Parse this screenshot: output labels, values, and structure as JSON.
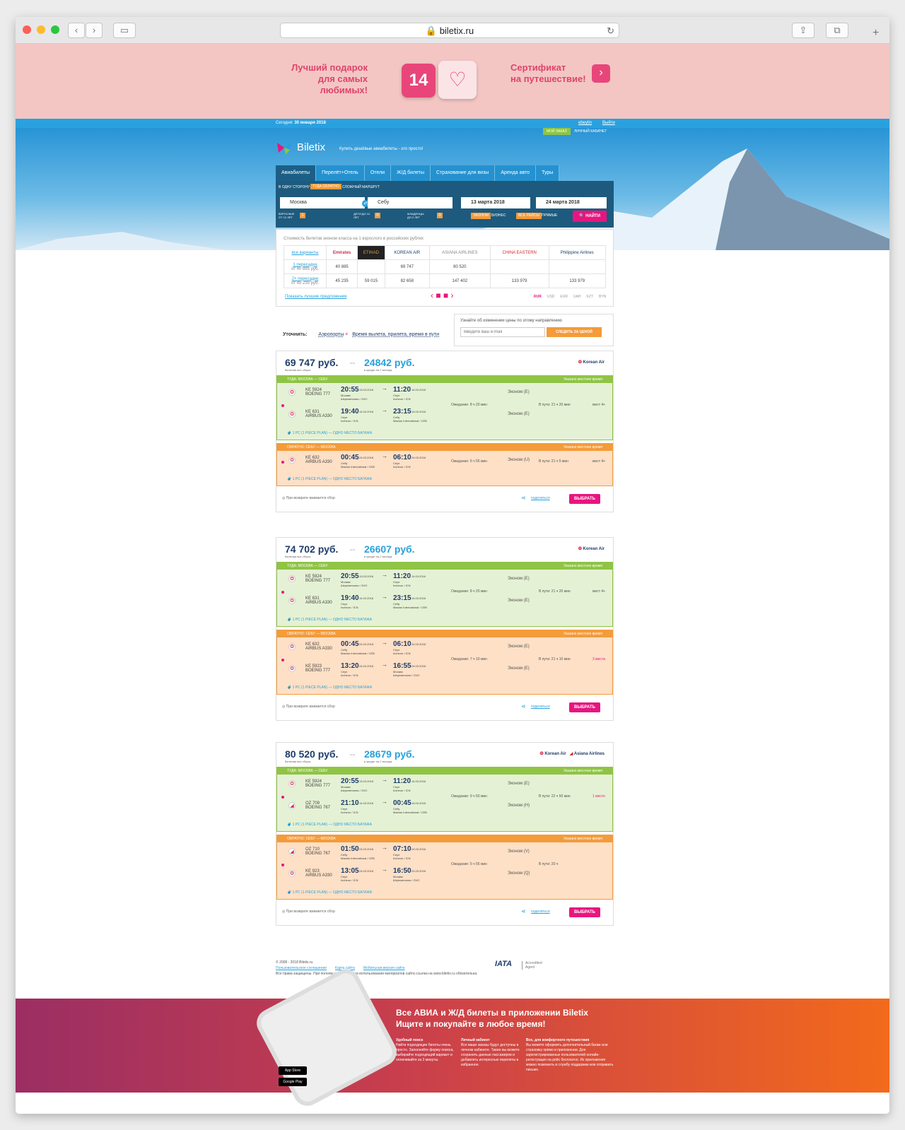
{
  "browser": {
    "url": "biletix.ru"
  },
  "banner": {
    "left": "Лучший подарок\nдля самых любимых!",
    "date": "14",
    "right": "Сертификат\nна путешествие!"
  },
  "header": {
    "today_label": "Сегодня:",
    "today": "30 января 2018",
    "user": "ebeylin",
    "logout": "Выйти",
    "my_order": "МОЙ ЗАКАЗ",
    "cabinet": "ЛИЧНЫЙ КАБИНЕТ",
    "brand": "Biletix",
    "tagline": "Купить дешёвые авиабилеты - это просто!"
  },
  "tabs": [
    "Авиабилеты",
    "Перелёт+Отель",
    "Отели",
    "Ж/Д билеты",
    "Страхование для визы",
    "Аренда авто",
    "Туры"
  ],
  "form": {
    "modes": [
      "В ОДНУ СТОРОНУ",
      "ТУДА-ОБРАТНО",
      "СЛОЖНЫЙ МАРШРУТ"
    ],
    "from": "Москва",
    "to": "Себу",
    "date1": "13 марта 2018",
    "date2": "24 марта 2018",
    "adults": "ВЗРОСЛЫЕ ОТ 12 ЛЕТ",
    "children": "ДЕТИ ДО 12 ЛЕТ",
    "infants": "МЛАДЕНЦЫ ДО 2 ЛЕТ",
    "adults_n": "1",
    "zero": "0",
    "classes": [
      "ЭКОНОМ",
      "БИЗНЕС"
    ],
    "flights": [
      "ВСЕ РЕЙСЫ",
      "ПРЯМЫЕ"
    ],
    "search": "НАЙТИ"
  },
  "matrix": {
    "title": "Стоимость билетов эконом класса на 1 взрослого в российских рублях",
    "airlines": [
      "Emirates",
      "ETIHAD",
      "KOREAN AIR",
      "ASIANA AIRLINES",
      "CHINA EASTERN",
      "Philippine Airlines"
    ],
    "rows": [
      {
        "label": "все варианты",
        "sub": ""
      },
      {
        "label": "1 пересадка",
        "sub": "от 40 885 руб.",
        "cells": [
          "40 885",
          "",
          "69 747",
          "80 520",
          "",
          ""
        ]
      },
      {
        "label": "2+ пересадки",
        "sub": "от 45 235 руб.",
        "cells": [
          "45 235",
          "59 015",
          "82 658",
          "147 402",
          "133 979",
          "133 979"
        ]
      }
    ],
    "best": "Показать лучшие предложения",
    "currencies": [
      "RUR",
      "USD",
      "EUR",
      "UAH",
      "KZT",
      "BYN"
    ]
  },
  "notify": {
    "text": "Узнайте об изменении цены по этому направлению",
    "placeholder": "Введите ваш e-mail",
    "button": "СЛЕДИТЬ ЗА ЦЕНОЙ"
  },
  "filters": {
    "label": "Уточнить:",
    "airports": "Аэропорты",
    "times": "Время вылета, прилета, время в пути"
  },
  "common": {
    "fees": "Включая все сборы",
    "or": "или",
    "credit": "в кредит на 2 месяца",
    "local": "Указано местное время",
    "baggage": "1 PC (1 PIECE PLAN) — ОДНО МЕСТО БАГАЖА",
    "refund": "При возврате взимается сбор",
    "share": "поделиться",
    "choose": "ВЫБРАТЬ"
  },
  "offers": [
    {
      "price": "69 747 руб.",
      "credit": "24842 руб.",
      "airline": "Korean Air",
      "there_title": "ТУДА: МОСКВА — СЕБУ",
      "back_title": "ОБРАТНО: СЕБУ — МОСКВА",
      "there": [
        {
          "num": "KE 5924",
          "ac": "BOEING 777",
          "dep": "20:55",
          "dd": "13.03.2018",
          "dc": "Москва",
          "da": "Шереметьево / SVO",
          "arr": "11:20",
          "ad": "14.03.2018",
          "ac2": "Сеул",
          "aa": "Incheon / ICN",
          "cls": "Эконом (E)"
        },
        {
          "num": "KE 631",
          "ac": "AIRBUS A330",
          "dep": "19:40",
          "dd": "14.03.2018",
          "dc": "Сеул",
          "da": "Incheon / ICN",
          "arr": "23:15",
          "ad": "14.03.2018",
          "ac2": "Себу",
          "aa": "Mactan International / CEB",
          "cls": "Эконом (E)"
        }
      ],
      "there_wait": "Ожидание: 8 ч 20 мин",
      "there_time": "В пути: 21 ч 20 мин",
      "there_seats": "мест 4+",
      "back": [
        {
          "num": "KE 632",
          "ac": "AIRBUS A330",
          "dep": "00:45",
          "dd": "24.03.2018",
          "dc": "Себу",
          "da": "Mactan International / CEB",
          "arr": "06:10",
          "ad": "24.03.2018",
          "ac2": "Сеул",
          "aa": "Incheon / ICN",
          "cls": "Эконом (U)"
        }
      ],
      "back_wait": "Ожидание: 6 ч 55 мин",
      "back_time": "В пути: 21 ч 5 мин",
      "back_seats": "мест 4+"
    },
    {
      "price": "74 702 руб.",
      "credit": "26607 руб.",
      "airline": "Korean Air",
      "there_title": "ТУДА: МОСКВА — СЕБУ",
      "back_title": "ОБРАТНО: СЕБУ — МОСКВА",
      "there": [
        {
          "num": "KE 5924",
          "ac": "BOEING 777",
          "dep": "20:55",
          "dd": "13.03.2018",
          "dc": "Москва",
          "da": "Шереметьево / SVO",
          "arr": "11:20",
          "ad": "14.03.2018",
          "ac2": "Сеул",
          "aa": "Incheon / ICN",
          "cls": "Эконом (E)"
        },
        {
          "num": "KE 631",
          "ac": "AIRBUS A330",
          "dep": "19:40",
          "dd": "14.03.2018",
          "dc": "Сеул",
          "da": "Incheon / ICN",
          "arr": "23:15",
          "ad": "14.03.2018",
          "ac2": "Себу",
          "aa": "Mactan International / CEB",
          "cls": "Эконом (E)"
        }
      ],
      "there_wait": "Ожидание: 8 ч 20 мин",
      "there_time": "В пути: 21 ч 20 мин",
      "there_seats": "мест 4+",
      "back": [
        {
          "num": "KE 632",
          "ac": "AIRBUS A330",
          "dep": "00:45",
          "dd": "24.03.2018",
          "dc": "Себу",
          "da": "Mactan International / CEB",
          "arr": "06:10",
          "ad": "24.03.2018",
          "ac2": "Сеул",
          "aa": "Incheon / ICN",
          "cls": "Эконом (E)"
        },
        {
          "num": "KE 5923",
          "ac": "BOEING 777",
          "dep": "13:20",
          "dd": "24.03.2018",
          "dc": "Сеул",
          "da": "Incheon / ICN",
          "arr": "16:55",
          "ad": "24.03.2018",
          "ac2": "Москва",
          "aa": "Шереметьево / SVO",
          "cls": "Эконом (E)"
        }
      ],
      "back_wait": "Ожидание: 7 ч 10 мин",
      "back_time": "В пути: 21 ч 10 мин",
      "back_seats": "3 места"
    },
    {
      "price": "80 520 руб.",
      "credit": "28679 руб.",
      "airline": "Korean Air",
      "airline2": "Asiana Airlines",
      "there_title": "ТУДА: МОСКВА — СЕБУ",
      "back_title": "ОБРАТНО: СЕБУ — МОСКВА",
      "there": [
        {
          "num": "KE 5924",
          "ac": "BOEING 777",
          "dep": "20:55",
          "dd": "13.03.2018",
          "dc": "Москва",
          "da": "Шереметьево / SVO",
          "arr": "11:20",
          "ad": "14.03.2018",
          "ac2": "Сеул",
          "aa": "Incheon / ICN",
          "cls": "Эконом (E)"
        },
        {
          "num": "OZ 709",
          "ac": "BOEING 767",
          "dep": "21:10",
          "dd": "14.03.2018",
          "dc": "Сеул",
          "da": "Incheon / ICN",
          "arr": "00:45",
          "ad": "15.03.2018",
          "ac2": "Себу",
          "aa": "Mactan International / CEB",
          "cls": "Эконом (H)"
        }
      ],
      "there_wait": "Ожидание: 9 ч 50 мин",
      "there_time": "В пути: 22 ч 50 мин",
      "there_seats": "1 место",
      "back": [
        {
          "num": "OZ 710",
          "ac": "BOEING 767",
          "dep": "01:50",
          "dd": "24.03.2018",
          "dc": "Себу",
          "da": "Mactan International / CEB",
          "arr": "07:10",
          "ad": "24.03.2018",
          "ac2": "Сеул",
          "aa": "Incheon / ICN",
          "cls": "Эконом (V)"
        },
        {
          "num": "KE 923",
          "ac": "AIRBUS A330",
          "dep": "13:05",
          "dd": "24.03.2018",
          "dc": "Сеул",
          "da": "Incheon / ICN",
          "arr": "16:50",
          "ad": "24.03.2018",
          "ac2": "Москва",
          "aa": "Шереметьево / SVO",
          "cls": "Эконом (Q)"
        }
      ],
      "back_wait": "Ожидание: 5 ч 55 мин",
      "back_time": "В пути: 20 ч",
      "back_seats": ""
    }
  ],
  "footer": {
    "copy": "© 2008 - 2018 Biletix.ru",
    "links": [
      "Пользовательское соглашение",
      "Карта сайта",
      "Мобильная версия сайта"
    ],
    "rights": "Все права защищены. При полном или частичном использовании материалов сайта ссылка на www.biletix.ru обязательна.",
    "iata": "IATA",
    "accredited": "Accredited Agent"
  },
  "promo": {
    "title1": "Все АВИА и Ж/Д билеты в приложении Biletix",
    "title2": "Ищите и покупайте в любое время!",
    "cols": [
      {
        "h": "Удобный поиск",
        "t": "Найти подходящие билеты очень просто. Заполняйте форму поиска, выбирайте подходящий вариант и оплачивайте за 3 минуты."
      },
      {
        "h": "Личный кабинет",
        "t": "Все ваши заказы будут доступны в личном кабинете. Также вы можете сохранить данные пассажиров и добавлять интересные перелеты в избранное."
      },
      {
        "h": "Все, для комфортного путешествия",
        "t": "Вы можете оформить дополнительный багаж или страховку прямо в приложении. Для зарегистрированных пользователей онлайн-регистрация на рейс бесплатно. Из приложения можно позвонить в службу поддержки или отправить письмо."
      }
    ],
    "appstore": "App Store",
    "gplay": "Google Play"
  }
}
